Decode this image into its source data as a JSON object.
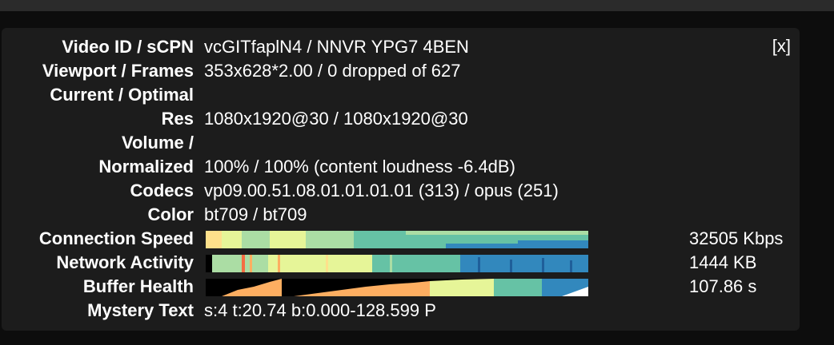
{
  "close_label": "[x]",
  "rows": [
    {
      "label": "Video ID / sCPN",
      "value": "vcGITfaplN4 / NNVR YPG7 4BEN"
    },
    {
      "label": "Viewport / Frames",
      "value": "353x628*2.00 / 0 dropped of 627"
    },
    {
      "label": "Current / Optimal",
      "value": ""
    },
    {
      "label": "Res",
      "value": "1080x1920@30 / 1080x1920@30"
    },
    {
      "label": "Volume /",
      "value": ""
    },
    {
      "label": "Normalized",
      "value": "100% / 100% (content loudness -6.4dB)"
    },
    {
      "label": "Codecs",
      "value": "vp09.00.51.08.01.01.01.01 (313) / opus (251)"
    },
    {
      "label": "Color",
      "value": "bt709 / bt709"
    }
  ],
  "connection": {
    "label": "Connection Speed",
    "value": "32505 Kbps"
  },
  "network": {
    "label": "Network Activity",
    "value": "1444 KB"
  },
  "buffer": {
    "label": "Buffer Health",
    "value": "107.86 s"
  },
  "mystery": {
    "label": "Mystery Text",
    "value": "s:4 t:20.74 b:0.000-128.599 P"
  },
  "colors": {
    "panel_bg": "#1c1c1c",
    "text": "#ffffff",
    "graph_palette": [
      "#9e0142",
      "#d53e4f",
      "#f46d43",
      "#fdae61",
      "#fee08b",
      "#e6f598",
      "#abdda4",
      "#66c2a5",
      "#3288bd"
    ]
  }
}
